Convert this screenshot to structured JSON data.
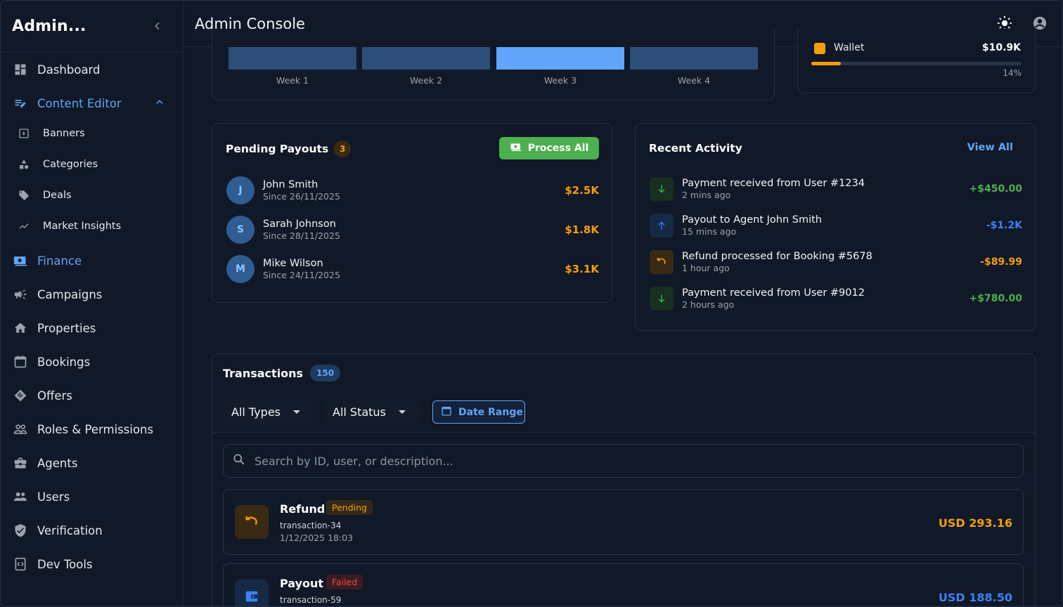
{
  "sidebar": {
    "brand": "Admin...",
    "collapse_icon": "chevron-left-icon",
    "items": [
      {
        "label": "Dashboard",
        "icon": "dashboard-icon"
      },
      {
        "label": "Content Editor",
        "icon": "edit-note-icon",
        "active": true
      },
      {
        "label": "Finance",
        "icon": "money-icon",
        "active": true
      },
      {
        "label": "Campaigns",
        "icon": "campaign-icon"
      },
      {
        "label": "Properties",
        "icon": "home-icon"
      },
      {
        "label": "Bookings",
        "icon": "calendar-icon"
      },
      {
        "label": "Offers",
        "icon": "offer-icon"
      },
      {
        "label": "Roles & Permissions",
        "icon": "people-outline-icon"
      },
      {
        "label": "Agents",
        "icon": "briefcase-icon"
      },
      {
        "label": "Users",
        "icon": "users-icon"
      },
      {
        "label": "Verification",
        "icon": "shield-check-icon"
      },
      {
        "label": "Dev Tools",
        "icon": "code-icon"
      }
    ],
    "sub_items": [
      {
        "label": "Banners",
        "icon": "play-box-icon"
      },
      {
        "label": "Categories",
        "icon": "shapes-icon"
      },
      {
        "label": "Deals",
        "icon": "tag-icon"
      },
      {
        "label": "Market Insights",
        "icon": "trend-icon"
      }
    ]
  },
  "header": {
    "title": "Admin Console",
    "theme_icon": "sun-icon",
    "account_icon": "account-circle-icon"
  },
  "chart": {
    "weeks": [
      "Week 1",
      "Week 2",
      "Week 3",
      "Week 4"
    ],
    "highlight_color": "#60a5fa",
    "bar_color": "#2d4e78"
  },
  "wallet": {
    "label": "Wallet",
    "amount": "$10.9K",
    "percent_label": "14%",
    "percent": 14,
    "color": "#f59e0b"
  },
  "pending_payouts": {
    "title": "Pending Payouts",
    "count": "3",
    "process_label": "Process All",
    "rows": [
      {
        "initial": "J",
        "name": "John Smith",
        "since": "Since 26/11/2025",
        "amount": "$2.5K"
      },
      {
        "initial": "S",
        "name": "Sarah Johnson",
        "since": "Since 28/11/2025",
        "amount": "$1.8K"
      },
      {
        "initial": "M",
        "name": "Mike Wilson",
        "since": "Since 24/11/2025",
        "amount": "$3.1K"
      }
    ]
  },
  "recent_activity": {
    "title": "Recent Activity",
    "view_all": "View All",
    "rows": [
      {
        "icon": "arrow-down-icon",
        "desc": "Payment received from User #1234",
        "time": "2 mins ago",
        "amount": "+$450.00",
        "color": "#4caf50"
      },
      {
        "icon": "arrow-up-icon",
        "desc": "Payout to Agent John Smith",
        "time": "15 mins ago",
        "amount": "-$1.2K",
        "color": "#3b82f6"
      },
      {
        "icon": "undo-icon",
        "desc": "Refund processed for Booking #5678",
        "time": "1 hour ago",
        "amount": "-$89.99",
        "color": "#f59e0b"
      },
      {
        "icon": "arrow-down-icon",
        "desc": "Payment received from User #9012",
        "time": "2 hours ago",
        "amount": "+$780.00",
        "color": "#4caf50"
      }
    ]
  },
  "transactions": {
    "title": "Transactions",
    "count": "150",
    "filter_type": "All Types",
    "filter_status": "All Status",
    "date_range": "Date Range",
    "search_placeholder": "Search by ID, user, or description...",
    "items": [
      {
        "type": "Refund",
        "status": "Pending",
        "id": "transaction-34",
        "date": "1/12/2025 18:03",
        "amount": "USD 293.16",
        "icon": "undo-icon"
      },
      {
        "type": "Payout",
        "status": "Failed",
        "id": "transaction-59",
        "date": "",
        "amount": "USD 188.50",
        "icon": "wallet-icon"
      }
    ]
  }
}
